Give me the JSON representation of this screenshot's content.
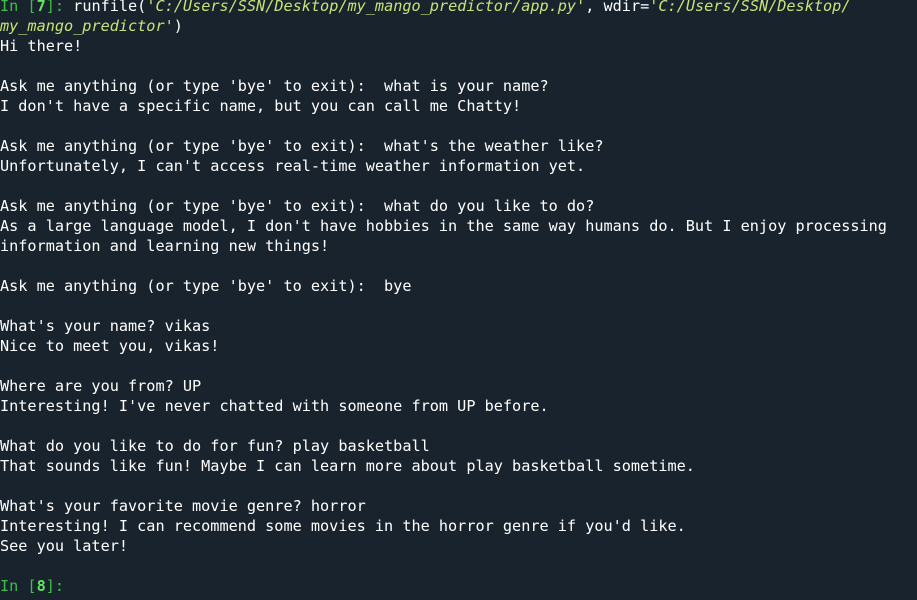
{
  "console": {
    "run_prompt": {
      "in_label": "In [",
      "in_number": "7",
      "in_close": "]: ",
      "call_open": "runfile(",
      "file_path": "'C:/Users/SSN/Desktop/my_mango_predictor/app.py'",
      "sep": ", wdir=",
      "wdir_line1": "'C:/Users/SSN/Desktop/",
      "wdir_line2": "my_mango_predictor'",
      "call_close": ")"
    },
    "output_lines": [
      "Hi there!",
      "",
      "Ask me anything (or type 'bye' to exit):  what is your name?",
      "I don't have a specific name, but you can call me Chatty!",
      "",
      "Ask me anything (or type 'bye' to exit):  what's the weather like?",
      "Unfortunately, I can't access real-time weather information yet.",
      "",
      "Ask me anything (or type 'bye' to exit):  what do you like to do?",
      "As a large language model, I don't have hobbies in the same way humans do. But I enjoy processing",
      "information and learning new things!",
      "",
      "Ask me anything (or type 'bye' to exit):  bye",
      "",
      "What's your name? vikas",
      "Nice to meet you, vikas!",
      "",
      "Where are you from? UP",
      "Interesting! I've never chatted with someone from UP before.",
      "",
      "What do you like to do for fun? play basketball",
      "That sounds like fun! Maybe I can learn more about play basketball sometime.",
      "",
      "What's your favorite movie genre? horror",
      "Interesting! I can recommend some movies in the horror genre if you'd like.",
      "See you later!",
      ""
    ],
    "next_prompt": {
      "in_label": "In [",
      "in_number": "8",
      "in_close": "]: "
    }
  },
  "colors": {
    "background": "#19232d",
    "prompt_green": "#3fbf45",
    "prompt_number": "#5fe85f",
    "string_literal": "#c5e478",
    "text": "#ffffff"
  }
}
